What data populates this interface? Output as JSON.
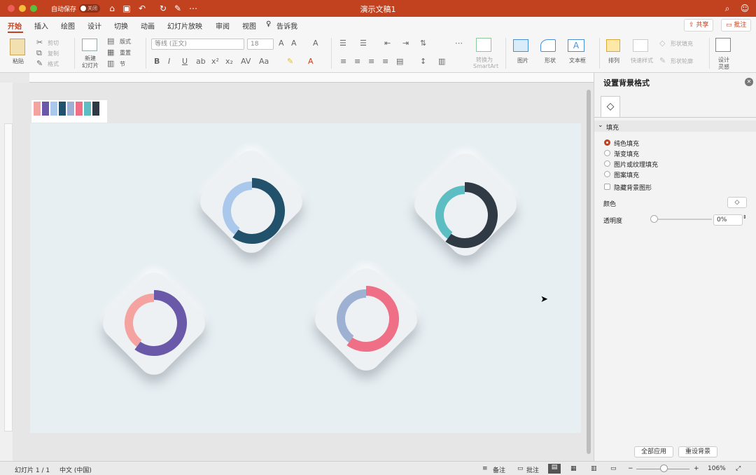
{
  "titlebar": {
    "autosave": "自动保存",
    "autosave_state": "关闭",
    "title": "演示文稿1"
  },
  "tabs": [
    "开始",
    "插入",
    "绘图",
    "设计",
    "切换",
    "动画",
    "幻灯片放映",
    "审阅",
    "视图"
  ],
  "tell_me": "告诉我",
  "share": "共享",
  "comments": "批注",
  "ribbon": {
    "paste": "粘贴",
    "cut": "剪切",
    "copy": "复制",
    "format": "格式",
    "new_slide": "新建\n幻灯片",
    "new_slide_1": "新建",
    "new_slide_2": "幻灯片",
    "layout": "版式",
    "reset": "重置",
    "section": "节",
    "font_name": "等线 (正文)",
    "font_size": "18",
    "convert_1": "转换为",
    "convert_2": "SmartArt",
    "picture": "图片",
    "shape": "形状",
    "textbox": "文本框",
    "arrange": "排列",
    "quick_styles": "快速样式",
    "shape_fill": "形状填充",
    "shape_outline": "形状轮廓",
    "design_1": "设计",
    "design_2": "灵感"
  },
  "swatches": [
    "#f4a3a0",
    "#6a59a8",
    "#a9c8ec",
    "#21516b",
    "#9fb1d2",
    "#ef6f86",
    "#5cbdc3",
    "#2f3a45"
  ],
  "pane": {
    "title": "设置背景格式",
    "section": "填充",
    "options": [
      "纯色填充",
      "渐变填充",
      "图片或纹理填充",
      "图案填充"
    ],
    "selected": "纯色填充",
    "hide_bg": "隐藏背景图形",
    "color_label": "颜色",
    "transparency_label": "透明度",
    "transparency": "0%",
    "apply_all": "全部应用",
    "reset_bg": "重设背景"
  },
  "status": {
    "slide": "幻灯片 1 / 1",
    "lang": "中文 (中国)",
    "notes": "备注",
    "comments": "批注",
    "zoom": "106%"
  },
  "rings": [
    {
      "light": "#a9c8ec",
      "dark": "#21516b",
      "dark_frac": 0.6
    },
    {
      "light": "#5cbdc3",
      "dark": "#2f3a45",
      "dark_frac": 0.6
    },
    {
      "light": "#f4a3a0",
      "dark": "#6a59a8",
      "dark_frac": 0.6
    },
    {
      "light": "#9fb1d2",
      "dark": "#ef6f86",
      "dark_frac": 0.6
    }
  ]
}
